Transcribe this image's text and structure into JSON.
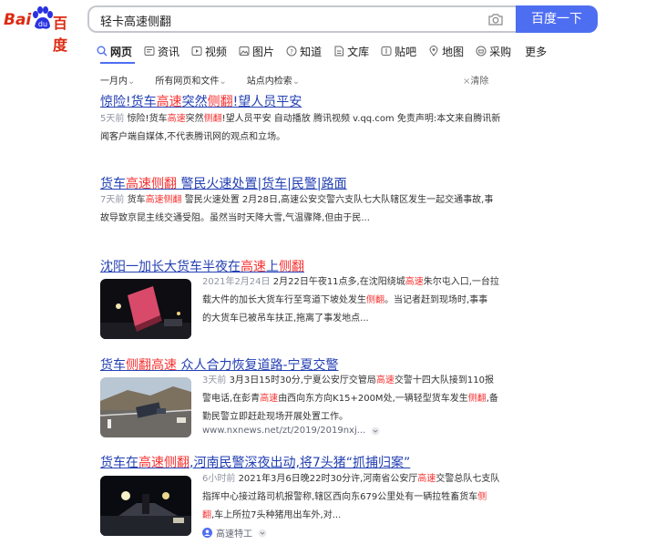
{
  "logo": {
    "text_bai": "Bai",
    "text_du": "百度"
  },
  "search": {
    "query": "轻卡高速侧翻",
    "button_label": "百度一下"
  },
  "tabs": [
    {
      "label": "网页",
      "icon": "search-icon"
    },
    {
      "label": "资讯",
      "icon": "news-icon"
    },
    {
      "label": "视频",
      "icon": "video-icon"
    },
    {
      "label": "图片",
      "icon": "image-icon"
    },
    {
      "label": "知道",
      "icon": "question-icon"
    },
    {
      "label": "文库",
      "icon": "doc-icon"
    },
    {
      "label": "贴吧",
      "icon": "tieba-icon"
    },
    {
      "label": "地图",
      "icon": "map-icon"
    },
    {
      "label": "采购",
      "icon": "purchase-icon"
    },
    {
      "label": "更多",
      "icon": ""
    }
  ],
  "filters": {
    "time": "一月内",
    "scope": "所有网页和文件",
    "site": "站点内检索",
    "clear": "清除"
  },
  "results": [
    {
      "title_parts": [
        "惊险!货车",
        "高速",
        "突然",
        "侧翻",
        "!望人员平安"
      ],
      "time": "5天前",
      "line1_parts": [
        "惊险!货车",
        "高速",
        "突然",
        "侧翻",
        "!望人员平安 自动播放 腾讯视频 v.qq.com 免责声明:本文来自腾讯新"
      ],
      "line2": "闻客户端自媒体,不代表腾讯网的观点和立场。"
    },
    {
      "title_parts": [
        "货车",
        "高速侧翻",
        " 警民火速处置|货车|民警|路面"
      ],
      "time": "7天前",
      "line1_parts": [
        "货车",
        "高速侧翻",
        " 警民火速处置 2月28日,高速公安交警六支队七大队辖区发生一起交通事故,事"
      ],
      "line2": "故导致京昆主线交通受阻。虽然当时天降大雪,气温骤降,但由于民..."
    },
    {
      "title_parts": [
        "沈阳一加长大货车半夜在",
        "高速",
        "上",
        "侧翻"
      ],
      "time": "2021年2月24日",
      "line1_parts": [
        "2月22日午夜11点多,在沈阳绕城",
        "高速",
        "朱尔屯入口,一台拉"
      ],
      "line2_parts": [
        "载大件的加长大货车行至弯道下坡处发生",
        "侧翻",
        "。当记者赶到现场时,事事"
      ],
      "line3": "的大货车已被吊车扶正,拖离了事发地点..."
    },
    {
      "title_parts": [
        "货车",
        "侧翻高速",
        " 众人合力恢复道路-宁夏交警"
      ],
      "time": "3天前",
      "line1_parts": [
        "3月3日15时30分,宁夏公安厅交管局",
        "高速",
        "交警十四大队接到110报"
      ],
      "line2_parts": [
        "警电话,在彭青",
        "高速",
        "由西向东方向K15+200M处,一辆轻型货车发生",
        "侧翻",
        ",备"
      ],
      "line3": "勤民警立即赶赴现场开展处置工作。",
      "source": "www.nxnews.net/zt/2019/2019nxj..."
    },
    {
      "title_parts": [
        "货车在",
        "高速侧翻",
        ",河南民警深夜出动,将7头猪“抓捕归案”"
      ],
      "time": "6小时前",
      "line1_parts": [
        "2021年3月6日晚22时30分许,河南省公安厅",
        "高速",
        "交警总队七支队"
      ],
      "line2_parts": [
        "指挥中心接过路司机报警称,辖区西向东679公里处有一辆拉牲畜货车",
        "侧"
      ],
      "line3_parts": [
        "翻",
        ",车上所拉7头种猪甩出车外,对..."
      ],
      "source": "高速特工"
    }
  ]
}
